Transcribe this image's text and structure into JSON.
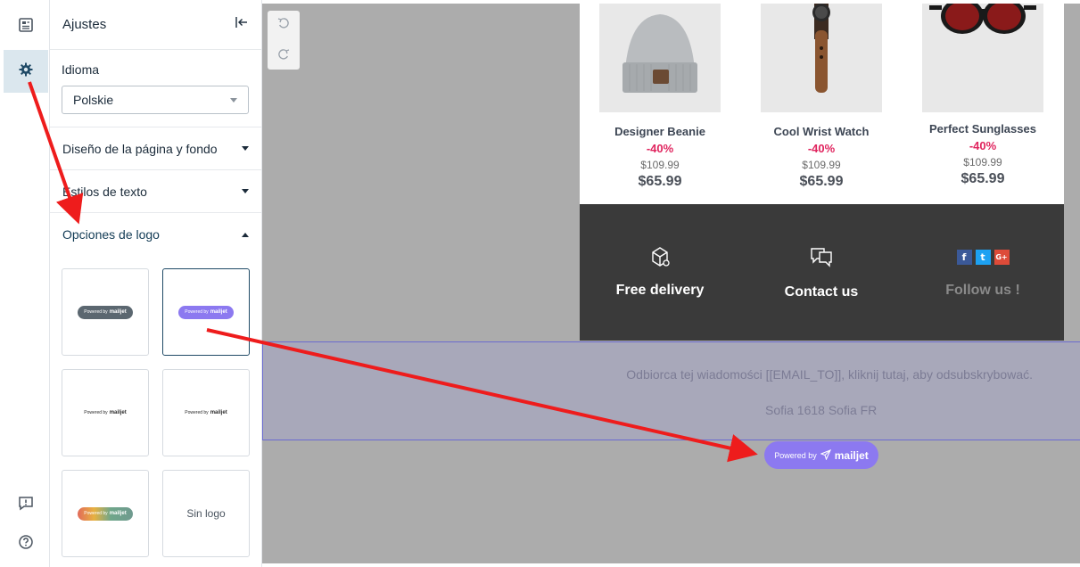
{
  "sidebar_rail": {
    "items": [
      {
        "icon": "layout-icon",
        "active": false
      },
      {
        "icon": "gear-icon",
        "active": true
      },
      {
        "icon": "feedback-icon",
        "active": false
      },
      {
        "icon": "help-icon",
        "active": false
      }
    ]
  },
  "settings_panel": {
    "title": "Ajustes",
    "language": {
      "label": "Idioma",
      "selected": "Polskie"
    },
    "sections": [
      {
        "label": "Diseño de la página y fondo",
        "expanded": false
      },
      {
        "label": "Estilos de texto",
        "expanded": false
      },
      {
        "label": "Opciones de logo",
        "expanded": true
      }
    ],
    "logo_options": [
      {
        "style": "dark",
        "text": "Powered by",
        "brand": "mailjet",
        "selected": false
      },
      {
        "style": "purple",
        "text": "Powered by",
        "brand": "mailjet",
        "selected": true
      },
      {
        "style": "plain",
        "text": "Powered by",
        "brand": "mailjet",
        "selected": false
      },
      {
        "style": "plain",
        "text": "Powered by",
        "brand": "mailjet",
        "selected": false
      },
      {
        "style": "multi",
        "text": "Powered by",
        "brand": "mailjet",
        "selected": false
      },
      {
        "style": "none",
        "label": "Sin logo",
        "selected": false
      }
    ]
  },
  "email_preview": {
    "products": [
      {
        "name": "Designer Beanie",
        "discount": "-40%",
        "old_price": "$109.99",
        "new_price": "$65.99"
      },
      {
        "name": "Cool Wrist Watch",
        "discount": "-40%",
        "old_price": "$109.99",
        "new_price": "$65.99"
      },
      {
        "name": "Perfect Sunglasses",
        "discount": "-40%",
        "old_price": "$109.99",
        "new_price": "$65.99"
      }
    ],
    "features": [
      {
        "label": "Free delivery",
        "icon": "delivery-box-icon"
      },
      {
        "label": "Contact us",
        "icon": "chat-bubbles-icon"
      },
      {
        "label": "Follow us !",
        "icon": "social-icons"
      }
    ],
    "social": {
      "facebook": "f",
      "twitter": "t",
      "googleplus": "G+"
    },
    "unsubscribe_text": "Odbiorca tej wiadomości [[EMAIL_TO]], kliknij tutaj, aby odsubskrybować.",
    "address": "Sofia 1618 Sofia FR",
    "powered_badge": {
      "text": "Powered by",
      "brand": "mailjet"
    }
  },
  "colors": {
    "accent": "#8c79f0",
    "annotation_arrow": "#ee1c1c",
    "discount": "#e0245e",
    "footer_dark": "#3a3a3a"
  }
}
